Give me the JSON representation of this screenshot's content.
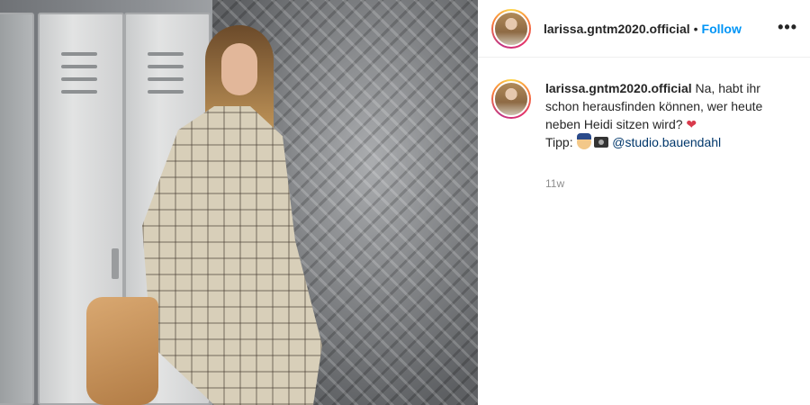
{
  "post": {
    "username": "larissa.gntm2020.official",
    "separator": "•",
    "follow_label": "Follow",
    "more_label": "•••",
    "caption_line1": "Na, habt ihr schon herausfinden können, wer heute neben Heidi sitzen wird?",
    "tip_label": "Tipp:",
    "mention": "@studio.bauendahl",
    "time_ago": "11w",
    "icons": [
      "heart-icon",
      "police-officer-emoji",
      "camera-emoji",
      "more-options-icon"
    ],
    "colors": {
      "follow": "#0095f6",
      "mention": "#00376b",
      "time": "#8e8e8e",
      "heart": "#d93a4c"
    }
  }
}
